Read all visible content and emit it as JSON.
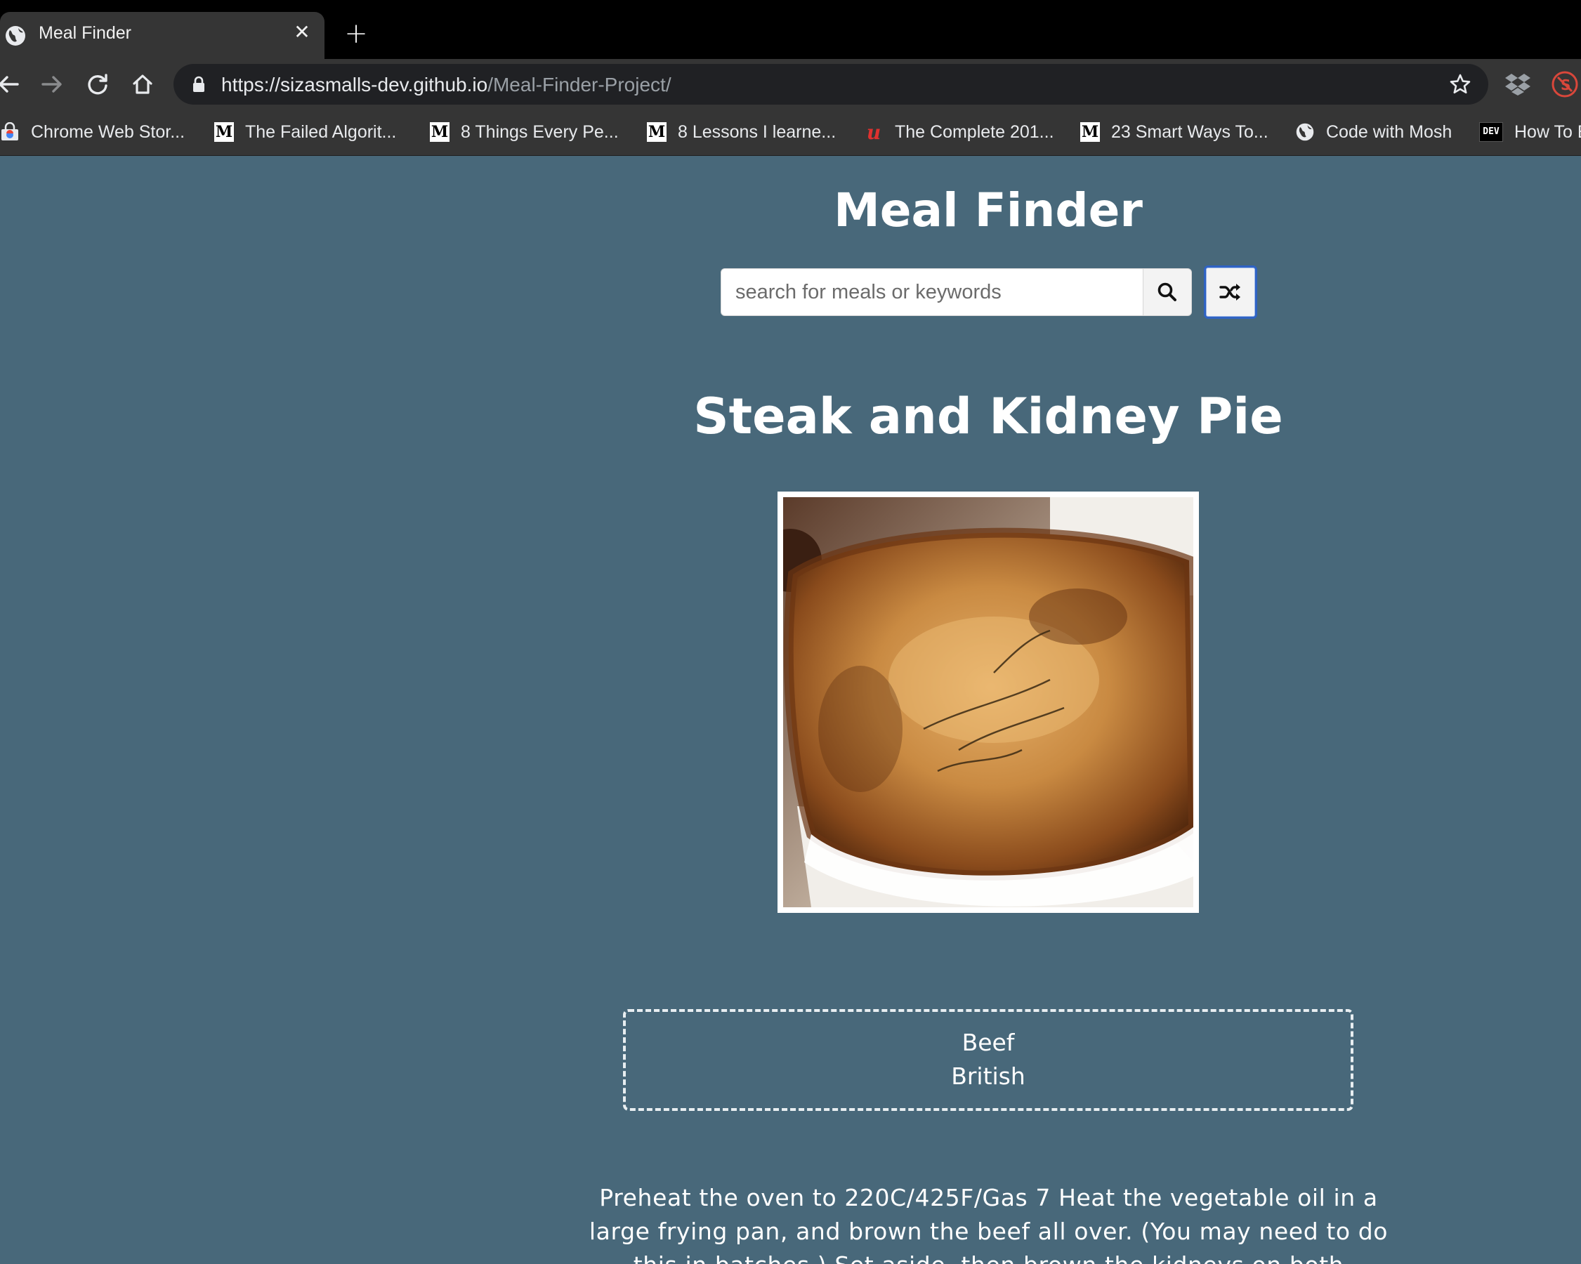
{
  "browser": {
    "tab": {
      "title": "Meal Finder",
      "close_glyph": "✕"
    },
    "new_tab_glyph": "+",
    "address": {
      "host": "https://sizasmalls-dev.github.io",
      "path": "/Meal-Finder-Project/"
    },
    "bookmarks": [
      {
        "icon": "chrome-web-store-icon",
        "label": "Chrome Web Stor..."
      },
      {
        "icon": "medium-icon",
        "label": "The Failed Algorit..."
      },
      {
        "icon": "medium-icon",
        "label": "8 Things Every Pe..."
      },
      {
        "icon": "medium-icon",
        "label": "8 Lessons I learne..."
      },
      {
        "icon": "udemy-icon",
        "label": "The Complete 201..."
      },
      {
        "icon": "medium-icon",
        "label": "23 Smart Ways To..."
      },
      {
        "icon": "globe-icon",
        "label": "Code with Mosh"
      },
      {
        "icon": "dev-icon",
        "label": "How To B"
      }
    ]
  },
  "app": {
    "title": "Meal Finder",
    "search": {
      "placeholder": "search for meals or keywords",
      "value": ""
    }
  },
  "meal": {
    "name": "Steak and Kidney Pie",
    "category": "Beef",
    "area": "British",
    "instructions": "Preheat the oven to 220C/425F/Gas 7 Heat the vegetable oil in a large frying pan, and brown the beef all over. (You may need to do this in batches.) Set aside, then brown the kidneys on both"
  },
  "colors": {
    "page_bg": "#48687a",
    "accent_border": "#2f63c4",
    "chrome_bg": "#353535"
  }
}
